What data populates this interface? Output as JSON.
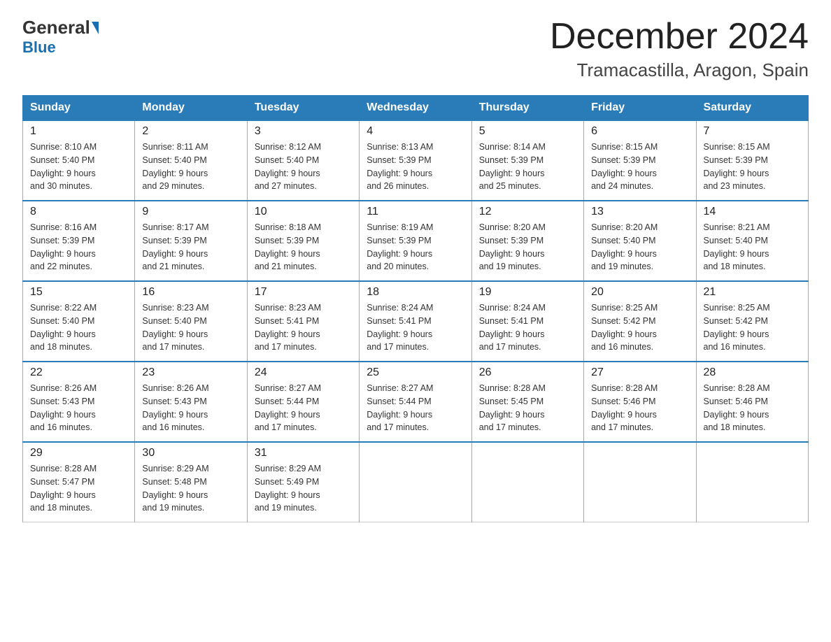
{
  "logo": {
    "general": "General",
    "blue": "Blue"
  },
  "title": "December 2024",
  "subtitle": "Tramacastilla, Aragon, Spain",
  "weekdays": [
    "Sunday",
    "Monday",
    "Tuesday",
    "Wednesday",
    "Thursday",
    "Friday",
    "Saturday"
  ],
  "weeks": [
    [
      {
        "day": "1",
        "sunrise": "8:10 AM",
        "sunset": "5:40 PM",
        "daylight": "9 hours and 30 minutes."
      },
      {
        "day": "2",
        "sunrise": "8:11 AM",
        "sunset": "5:40 PM",
        "daylight": "9 hours and 29 minutes."
      },
      {
        "day": "3",
        "sunrise": "8:12 AM",
        "sunset": "5:40 PM",
        "daylight": "9 hours and 27 minutes."
      },
      {
        "day": "4",
        "sunrise": "8:13 AM",
        "sunset": "5:39 PM",
        "daylight": "9 hours and 26 minutes."
      },
      {
        "day": "5",
        "sunrise": "8:14 AM",
        "sunset": "5:39 PM",
        "daylight": "9 hours and 25 minutes."
      },
      {
        "day": "6",
        "sunrise": "8:15 AM",
        "sunset": "5:39 PM",
        "daylight": "9 hours and 24 minutes."
      },
      {
        "day": "7",
        "sunrise": "8:15 AM",
        "sunset": "5:39 PM",
        "daylight": "9 hours and 23 minutes."
      }
    ],
    [
      {
        "day": "8",
        "sunrise": "8:16 AM",
        "sunset": "5:39 PM",
        "daylight": "9 hours and 22 minutes."
      },
      {
        "day": "9",
        "sunrise": "8:17 AM",
        "sunset": "5:39 PM",
        "daylight": "9 hours and 21 minutes."
      },
      {
        "day": "10",
        "sunrise": "8:18 AM",
        "sunset": "5:39 PM",
        "daylight": "9 hours and 21 minutes."
      },
      {
        "day": "11",
        "sunrise": "8:19 AM",
        "sunset": "5:39 PM",
        "daylight": "9 hours and 20 minutes."
      },
      {
        "day": "12",
        "sunrise": "8:20 AM",
        "sunset": "5:39 PM",
        "daylight": "9 hours and 19 minutes."
      },
      {
        "day": "13",
        "sunrise": "8:20 AM",
        "sunset": "5:40 PM",
        "daylight": "9 hours and 19 minutes."
      },
      {
        "day": "14",
        "sunrise": "8:21 AM",
        "sunset": "5:40 PM",
        "daylight": "9 hours and 18 minutes."
      }
    ],
    [
      {
        "day": "15",
        "sunrise": "8:22 AM",
        "sunset": "5:40 PM",
        "daylight": "9 hours and 18 minutes."
      },
      {
        "day": "16",
        "sunrise": "8:23 AM",
        "sunset": "5:40 PM",
        "daylight": "9 hours and 17 minutes."
      },
      {
        "day": "17",
        "sunrise": "8:23 AM",
        "sunset": "5:41 PM",
        "daylight": "9 hours and 17 minutes."
      },
      {
        "day": "18",
        "sunrise": "8:24 AM",
        "sunset": "5:41 PM",
        "daylight": "9 hours and 17 minutes."
      },
      {
        "day": "19",
        "sunrise": "8:24 AM",
        "sunset": "5:41 PM",
        "daylight": "9 hours and 17 minutes."
      },
      {
        "day": "20",
        "sunrise": "8:25 AM",
        "sunset": "5:42 PM",
        "daylight": "9 hours and 16 minutes."
      },
      {
        "day": "21",
        "sunrise": "8:25 AM",
        "sunset": "5:42 PM",
        "daylight": "9 hours and 16 minutes."
      }
    ],
    [
      {
        "day": "22",
        "sunrise": "8:26 AM",
        "sunset": "5:43 PM",
        "daylight": "9 hours and 16 minutes."
      },
      {
        "day": "23",
        "sunrise": "8:26 AM",
        "sunset": "5:43 PM",
        "daylight": "9 hours and 16 minutes."
      },
      {
        "day": "24",
        "sunrise": "8:27 AM",
        "sunset": "5:44 PM",
        "daylight": "9 hours and 17 minutes."
      },
      {
        "day": "25",
        "sunrise": "8:27 AM",
        "sunset": "5:44 PM",
        "daylight": "9 hours and 17 minutes."
      },
      {
        "day": "26",
        "sunrise": "8:28 AM",
        "sunset": "5:45 PM",
        "daylight": "9 hours and 17 minutes."
      },
      {
        "day": "27",
        "sunrise": "8:28 AM",
        "sunset": "5:46 PM",
        "daylight": "9 hours and 17 minutes."
      },
      {
        "day": "28",
        "sunrise": "8:28 AM",
        "sunset": "5:46 PM",
        "daylight": "9 hours and 18 minutes."
      }
    ],
    [
      {
        "day": "29",
        "sunrise": "8:28 AM",
        "sunset": "5:47 PM",
        "daylight": "9 hours and 18 minutes."
      },
      {
        "day": "30",
        "sunrise": "8:29 AM",
        "sunset": "5:48 PM",
        "daylight": "9 hours and 19 minutes."
      },
      {
        "day": "31",
        "sunrise": "8:29 AM",
        "sunset": "5:49 PM",
        "daylight": "9 hours and 19 minutes."
      },
      null,
      null,
      null,
      null
    ]
  ],
  "labels": {
    "sunrise": "Sunrise:",
    "sunset": "Sunset:",
    "daylight": "Daylight:"
  },
  "colors": {
    "header_bg": "#2a7cb8",
    "header_text": "#ffffff",
    "border_blue": "#2a7cb8"
  }
}
